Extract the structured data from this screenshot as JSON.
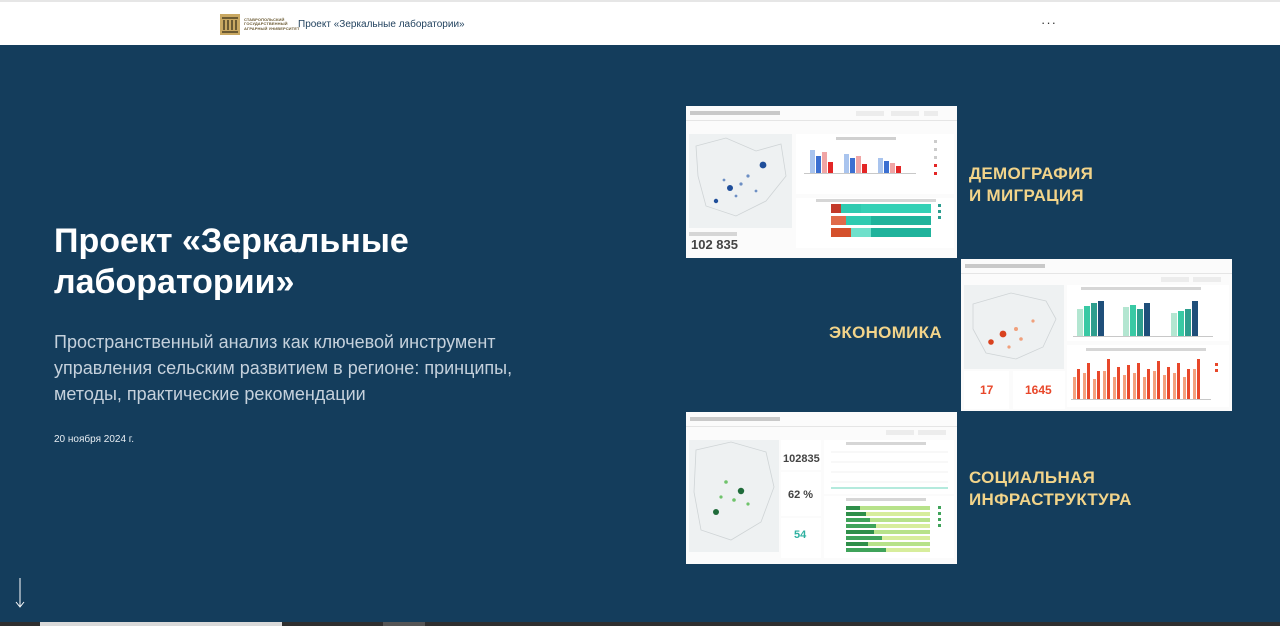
{
  "header": {
    "logo_text": "Ставропольский государственный аграрный университет",
    "title": "Проект «Зеркальные лаборатории»",
    "more_icon": "more-horizontal-icon",
    "more_label": "···"
  },
  "hero": {
    "title": "Проект «Зеркальные лаборатории»",
    "subtitle": "Пространственный анализ как ключевой инструмент управления сельским развитием в регионе: принципы, методы, практические рекомендации",
    "date": "20 ноября 2024 г.",
    "scroll_icon": "arrow-down-icon"
  },
  "cards": [
    {
      "label_line1": "ДЕМОГРАФИЯ",
      "label_line2": "И МИГРАЦИЯ",
      "kpi_a": "102 835"
    },
    {
      "label_line1": "ЭКОНОМИКА",
      "label_line2": "",
      "kpi_a": "17",
      "kpi_b": "1645"
    },
    {
      "label_line1": "СОЦИАЛЬНАЯ",
      "label_line2": "ИНФРАСТРУКТУРА",
      "kpi_a": "102835",
      "kpi_b": "62 %",
      "kpi_c": "54"
    }
  ],
  "colors": {
    "background": "#143d5c",
    "accent_label": "#f2d48a",
    "kpi_economy": "#e8472a",
    "kpi_social": "#2eb0a0"
  }
}
